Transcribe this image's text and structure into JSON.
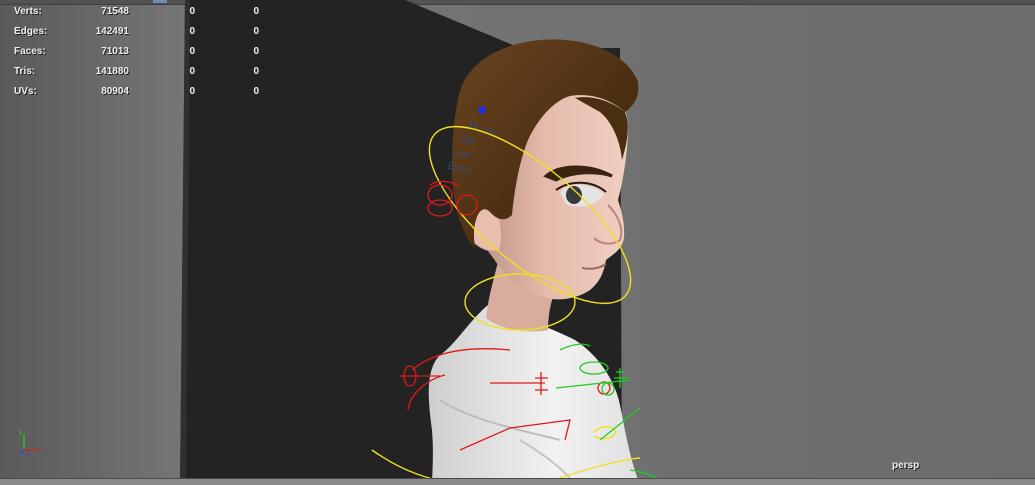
{
  "hud": {
    "rows": [
      {
        "label": "Verts:",
        "total": "71548",
        "selected": "0",
        "components": "0"
      },
      {
        "label": "Edges:",
        "total": "142491",
        "selected": "0",
        "components": "0"
      },
      {
        "label": "Faces:",
        "total": "71013",
        "selected": "0",
        "components": "0"
      },
      {
        "label": "Tris:",
        "total": "141880",
        "selected": "0",
        "components": "0"
      },
      {
        "label": "UVs:",
        "total": "80904",
        "selected": "0",
        "components": "0"
      }
    ]
  },
  "camera": {
    "name": "persp"
  },
  "rig_head_labels": {
    "all": "All",
    "upr": "Upr",
    "lwr": "Lwr",
    "eyes": "Eyes",
    "select": "Select"
  },
  "axis_gizmo": {
    "x": "x",
    "y": "y",
    "z": "z"
  },
  "colors": {
    "yellow_ctrl": "#f0e020",
    "red_ctrl": "#e01818",
    "green_ctrl": "#22cc22",
    "blue_ctrl": "#2030d0",
    "backdrop": "#232323",
    "hair": "#5a3a18",
    "skin": "#e2b8a8",
    "shirt": "#eeeeee"
  }
}
